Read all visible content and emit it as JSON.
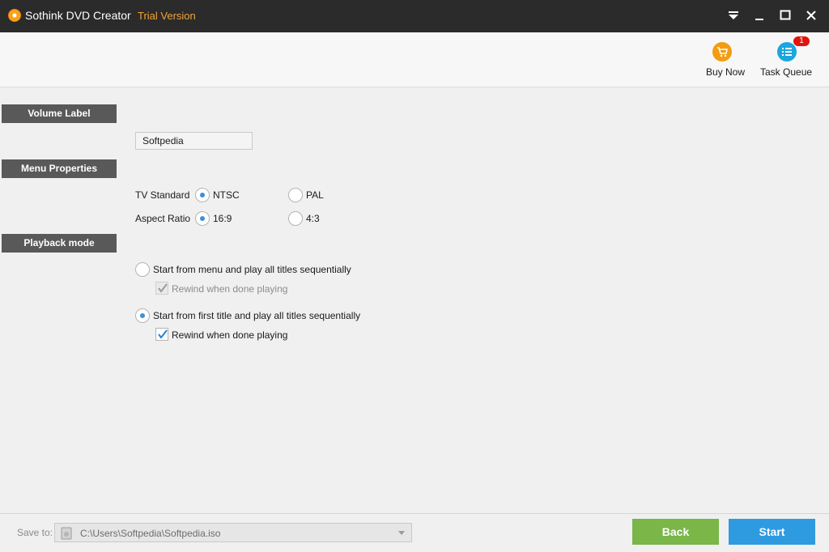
{
  "window": {
    "title": "Sothink DVD Creator",
    "edition": "Trial Version",
    "controls": [
      "menu-dropdown",
      "minimize",
      "maximize",
      "close"
    ]
  },
  "toolbar": {
    "buy_now": {
      "label": "Buy Now",
      "icon": "shopping-cart-icon",
      "color": "#f39c12"
    },
    "task_queue": {
      "label": "Task Queue",
      "icon": "list-icon",
      "color": "#1ba6e0",
      "badge": "1"
    }
  },
  "volume": {
    "header": "Volume Label",
    "value": "Softpedia"
  },
  "menu_properties": {
    "header": "Menu Properties",
    "tv_standard": {
      "label": "TV Standard",
      "options": [
        "NTSC",
        "PAL"
      ],
      "selected": "NTSC"
    },
    "aspect_ratio": {
      "label": "Aspect Ratio",
      "options": [
        "16:9",
        "4:3"
      ],
      "selected": "16:9"
    }
  },
  "playback": {
    "header": "Playback mode",
    "options": [
      {
        "label": "Start from menu and play all titles sequentially",
        "selected": false,
        "rewind_label": "Rewind when done playing",
        "rewind_checked": true,
        "rewind_enabled": false
      },
      {
        "label": "Start from first title and play all titles sequentially",
        "selected": true,
        "rewind_label": "Rewind when done playing",
        "rewind_checked": true,
        "rewind_enabled": true
      }
    ]
  },
  "footer": {
    "save_to_label": "Save to:",
    "save_path": "C:\\Users\\Softpedia\\Softpedia.iso",
    "back_label": "Back",
    "back_color": "#7ab648",
    "start_label": "Start",
    "start_color": "#2e9be0"
  }
}
